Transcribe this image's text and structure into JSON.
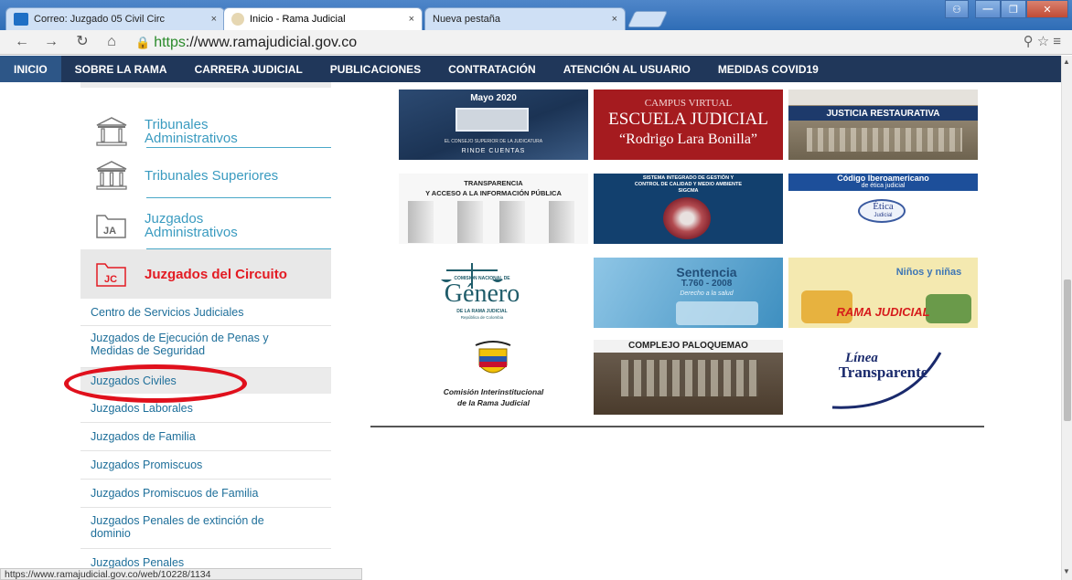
{
  "browser": {
    "tabs": [
      {
        "label": "Correo: Juzgado 05 Civil Circ",
        "close": "×"
      },
      {
        "label": "Inicio - Rama Judicial",
        "close": "×"
      },
      {
        "label": "Nueva pestaña",
        "close": "×"
      }
    ],
    "url_scheme": "https",
    "url_rest": "://www.ramajudicial.gov.co",
    "status_url": "https://www.ramajudicial.gov.co/web/10228/1134"
  },
  "nav": {
    "items": [
      "INICIO",
      "SOBRE LA RAMA",
      "CARRERA JUDICIAL",
      "PUBLICACIONES",
      "CONTRATACIÓN",
      "ATENCIÓN AL USUARIO",
      "MEDIDAS COVID19"
    ]
  },
  "sidebar": {
    "big_items": [
      {
        "label": "Tribunales Administrativos",
        "icon": "building-icon"
      },
      {
        "label": "Tribunales Superiores",
        "icon": "building-icon"
      },
      {
        "label": "Juzgados Administrativos",
        "icon": "folder-icon",
        "badge": "JA"
      },
      {
        "label": "Juzgados del Circuito",
        "icon": "folder-icon",
        "badge": "JC"
      }
    ],
    "small_items": [
      "Centro de Servicios Judiciales",
      "Juzgados de Ejecución de Penas y Medidas de Seguridad",
      "Juzgados Civiles",
      "Juzgados Laborales",
      "Juzgados de Familia",
      "Juzgados Promiscuos",
      "Juzgados Promiscuos de Familia",
      "Juzgados Penales de extinción de dominio",
      "Juzgados Penales"
    ]
  },
  "banners": {
    "mayo_title": "Mayo 2020",
    "mayo_rinde": "RINDE CUENTAS",
    "mayo_consejo": "EL CONSEJO SUPERIOR DE LA JUDICATURA",
    "campus_line1": "CAMPUS VIRTUAL",
    "campus_line2": "ESCUELA JUDICIAL",
    "campus_line3": "“Rodrigo Lara Bonilla”",
    "justicia": "JUSTICIA RESTAURATIVA",
    "transparencia_line1": "TRANSPARENCIA",
    "transparencia_line2": "Y ACCESO A LA INFORMACIÓN PÚBLICA",
    "sigcma_line1": "SISTEMA INTEGRADO DE GESTIÓN Y",
    "sigcma_line2": "CONTROL DE CALIDAD Y MEDIO AMBIENTE",
    "sigcma_line3": "SIGCMA",
    "codigo_line1": "Código Iberoamericano",
    "codigo_line2": "de ética judicial",
    "etica_word": "Ética",
    "etica_sub": "Judicial",
    "genero_comision": "COMISIÓN NACIONAL DE",
    "genero_word": "Género",
    "genero_rama": "DE LA RAMA JUDICIAL",
    "genero_rep": "República de Colombia",
    "sentencia_title": "Sentencia",
    "sentencia_num": "T.760 - 2008",
    "sentencia_sub": "Derecho a la salud",
    "ninos_title": "Niños y niñas",
    "ninos_banner": "RAMA JUDICIAL",
    "comision_line1": "Comisión Interinstitucional",
    "comision_line2": "de la Rama Judicial",
    "complejo": "COMPLEJO PALOQUEMAO",
    "linea_line1": "Línea",
    "linea_line2": "Transparente"
  },
  "colors": {
    "nav_bg": "#20375a",
    "link": "#1e6f9a",
    "active_red": "#e31b23",
    "circle": "#e0101c"
  }
}
